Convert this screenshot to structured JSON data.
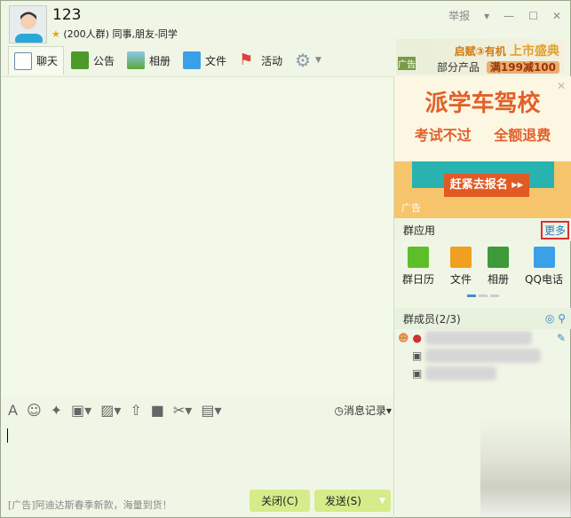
{
  "header": {
    "title": "123",
    "subtitle": "(200人群) 同事,朋友-同学",
    "report": "举报"
  },
  "tabs": [
    {
      "label": "聊天"
    },
    {
      "label": "公告"
    },
    {
      "label": "相册"
    },
    {
      "label": "文件"
    },
    {
      "label": "活动"
    }
  ],
  "top_ad": {
    "line1a": "启赋",
    "line1b": "有机",
    "line1c": "上市盛典",
    "line2a": "部分产品",
    "line2b": "满199减100",
    "tag": "广告"
  },
  "side_ad": {
    "headline": "派学车驾校",
    "subline": "考试不过 全额退费",
    "cta": "赶紧去报名 ▸▸",
    "tag": "广告"
  },
  "apps": {
    "title": "群应用",
    "more": "更多",
    "items": [
      {
        "label": "群日历",
        "color": "#5cbf2a"
      },
      {
        "label": "文件",
        "color": "#f0a020"
      },
      {
        "label": "相册",
        "color": "#3f9a3a"
      },
      {
        "label": "QQ电话",
        "color": "#3aa0e8"
      }
    ]
  },
  "members": {
    "title": "群成员(2/3)"
  },
  "toolbar": {
    "history": "消息记录"
  },
  "footer": {
    "ad": "[广告]阿迪达斯春季新款，海量到货！",
    "close": "关闭(C)",
    "send": "发送(S)"
  }
}
